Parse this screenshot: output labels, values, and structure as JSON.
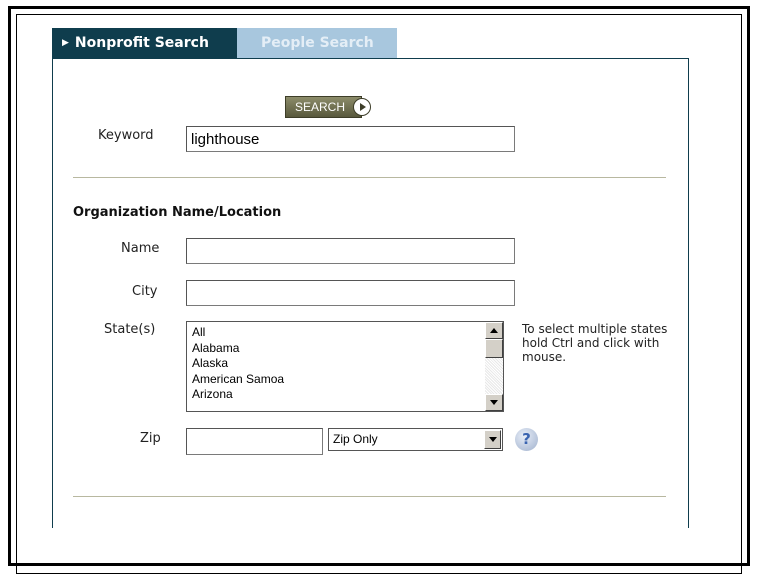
{
  "tabs": [
    {
      "label": "Nonprofit Search",
      "active": true
    },
    {
      "label": "People Search",
      "active": false
    }
  ],
  "search_button_label": "SEARCH",
  "keyword": {
    "label": "Keyword",
    "value": "lighthouse"
  },
  "org_section": {
    "title": "Organization Name/Location",
    "name_label": "Name",
    "name_value": "",
    "city_label": "City",
    "city_value": "",
    "states_label": "State(s)",
    "states_options": [
      "All",
      "Alabama",
      "Alaska",
      "American Samoa",
      "Arizona"
    ],
    "states_help": "To select multiple states hold Ctrl and click with mouse.",
    "zip_label": "Zip",
    "zip_value": "",
    "zip_mode_selected": "Zip Only"
  },
  "colors": {
    "tab_active_bg": "#0f3d4d",
    "tab_inactive_bg": "#a8c7de",
    "search_button_bg": "#6b6b4a"
  },
  "icons": {
    "tab_caret": "caret-right-icon",
    "search_play": "play-circle-icon",
    "help": "question-mark-icon"
  }
}
